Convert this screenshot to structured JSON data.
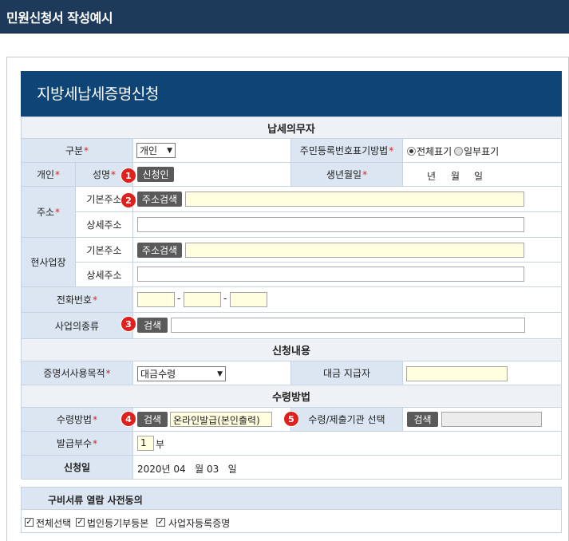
{
  "window": {
    "title": "민원신청서 작성예시"
  },
  "form": {
    "title": "지방세납세증명신청"
  },
  "sections": {
    "taxpayer": "납세의무자",
    "application": "신청내용",
    "receipt": "수령방법"
  },
  "taxpayer": {
    "type_label": "구분",
    "type_value": "개인",
    "id_display_label": "주민등록번호표기방법",
    "id_display_options": [
      "전체표기",
      "일부표기"
    ],
    "id_display_selected": "전체표기",
    "individual_label": "개인",
    "name_label": "성명",
    "applicant_button": "신청인",
    "birth_label": "생년월일",
    "birth_placeholder": {
      "year": "년",
      "month": "월",
      "day": "일"
    },
    "address_label": "주소",
    "basic_address_label": "기본주소",
    "address_search_button": "주소검색",
    "detail_address_label": "상세주소",
    "workplace_label": "현사업장",
    "workplace_basic_label": "기본주소",
    "workplace_search_button": "주소검색",
    "workplace_detail_label": "상세주소",
    "phone_label": "전화번호",
    "phone_sep": "-",
    "business_type_label": "사업의종류",
    "business_search_button": "검색"
  },
  "application": {
    "purpose_label": "증명서사용목적",
    "purpose_value": "대금수령",
    "payer_label": "대금 지급자"
  },
  "receipt": {
    "method_label": "수령방법",
    "method_search_button": "검색",
    "method_value": "온라인발급(본인출력)",
    "agency_label": "수령/제출기관 선택",
    "agency_search_button": "검색",
    "copies_label": "발급부수",
    "copies_value": "1",
    "copies_unit": "부",
    "date_label": "신청일",
    "date_value": "2020년 04   월 03   일"
  },
  "badges": [
    "1",
    "2",
    "3",
    "4",
    "5"
  ],
  "required_mark": "*",
  "consent": {
    "title": "구비서류 열람 사전동의",
    "items": [
      {
        "label": "전체선택",
        "checked": true
      },
      {
        "label": "법인등기부등본",
        "checked": true
      },
      {
        "label": "사업자등록증명",
        "checked": true
      }
    ]
  },
  "colors": {
    "topbar": "#1d3a5a",
    "form_header": "#0e4476",
    "label_bg": "#dbe6f2",
    "badge": "#e0201c",
    "button": "#5a5a5a",
    "input_highlight": "#ffffe0"
  }
}
